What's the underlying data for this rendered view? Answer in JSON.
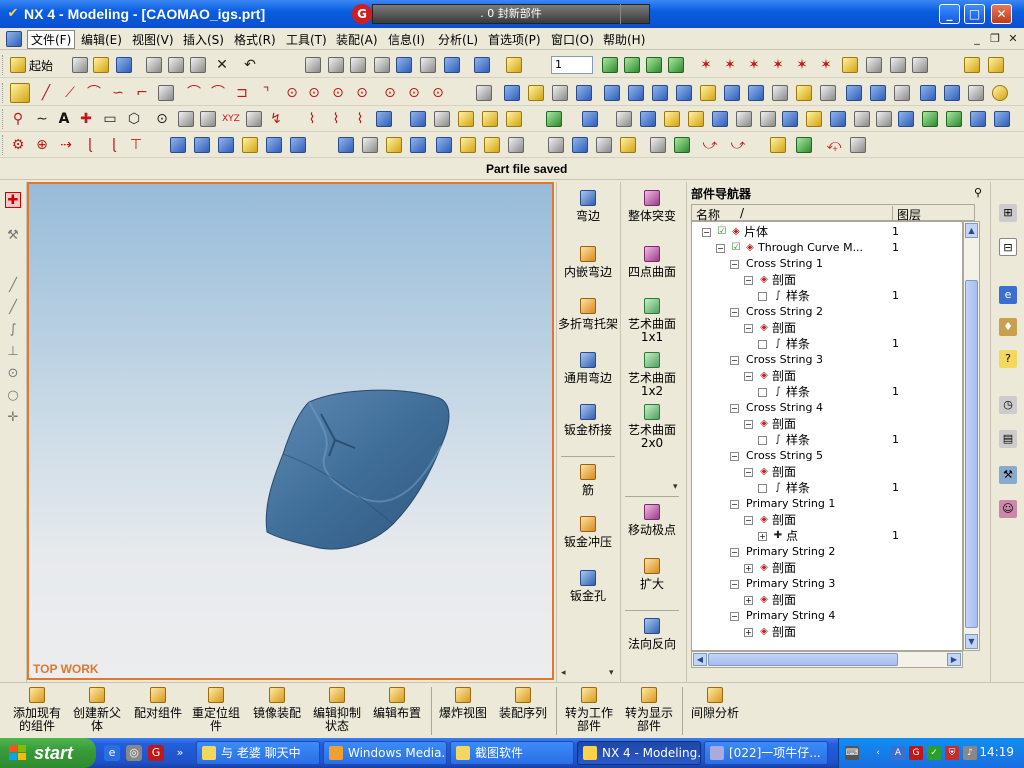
{
  "window": {
    "title": "NX 4 - Modeling - [CAOMAO_igs.prt]",
    "ext_bar_text": ". 0 封新部件",
    "controls": {
      "minimize": "_",
      "maximize": "□",
      "close": "✕"
    }
  },
  "menu": [
    {
      "label": "文件(F)"
    },
    {
      "label": "编辑(E)"
    },
    {
      "label": "视图(V)"
    },
    {
      "label": "插入(S)"
    },
    {
      "label": "格式(R)"
    },
    {
      "label": "工具(T)"
    },
    {
      "label": "装配(A)"
    },
    {
      "label": "信息(I)"
    },
    {
      "label": "分析(L)"
    },
    {
      "label": "首选项(P)"
    },
    {
      "label": "窗口(O)"
    },
    {
      "label": "帮助(H)"
    }
  ],
  "toolbar": {
    "start_label": "起始",
    "layer_value": "1"
  },
  "status_text": "Part file saved",
  "viewport": {
    "label": "TOP WORK",
    "model_color": "#3f6e98"
  },
  "palette_left": [
    {
      "label": "弯边"
    },
    {
      "label": "内嵌弯边"
    },
    {
      "label": "多折弯托架"
    },
    {
      "label": "通用弯边"
    },
    {
      "label": "钣金桥接"
    },
    {
      "label": "筋"
    },
    {
      "label": "钣金冲压"
    },
    {
      "label": "钣金孔"
    }
  ],
  "palette_right": [
    {
      "label": "整体突变",
      "sub": ""
    },
    {
      "label": "四点曲面",
      "sub": ""
    },
    {
      "label": "艺术曲面",
      "sub": "1x1"
    },
    {
      "label": "艺术曲面",
      "sub": "1x2"
    },
    {
      "label": "艺术曲面",
      "sub": "2x0"
    },
    {
      "label": "移动极点",
      "sub": ""
    },
    {
      "label": "扩大",
      "sub": ""
    },
    {
      "label": "法向反向",
      "sub": ""
    }
  ],
  "navigator": {
    "title": "部件导航器",
    "col_name": "名称",
    "col_sort": "/",
    "col_layer": "图层",
    "rows": [
      {
        "label": "片体",
        "layer": "1",
        "indent": 0,
        "exp": "−",
        "check": true
      },
      {
        "label": "Through Curve M...",
        "layer": "1",
        "indent": 1,
        "exp": "−",
        "check": true
      },
      {
        "label": "Cross String 1",
        "layer": "",
        "indent": 2,
        "exp": "−"
      },
      {
        "label": "剖面",
        "layer": "",
        "indent": 3,
        "exp": "−"
      },
      {
        "label": "样条",
        "layer": "1",
        "indent": 4,
        "exp": ""
      },
      {
        "label": "Cross String 2",
        "layer": "",
        "indent": 2,
        "exp": "−"
      },
      {
        "label": "剖面",
        "layer": "",
        "indent": 3,
        "exp": "−"
      },
      {
        "label": "样条",
        "layer": "1",
        "indent": 4,
        "exp": ""
      },
      {
        "label": "Cross String 3",
        "layer": "",
        "indent": 2,
        "exp": "−"
      },
      {
        "label": "剖面",
        "layer": "",
        "indent": 3,
        "exp": "−"
      },
      {
        "label": "样条",
        "layer": "1",
        "indent": 4,
        "exp": ""
      },
      {
        "label": "Cross String 4",
        "layer": "",
        "indent": 2,
        "exp": "−"
      },
      {
        "label": "剖面",
        "layer": "",
        "indent": 3,
        "exp": "−"
      },
      {
        "label": "样条",
        "layer": "1",
        "indent": 4,
        "exp": ""
      },
      {
        "label": "Cross String 5",
        "layer": "",
        "indent": 2,
        "exp": "−"
      },
      {
        "label": "剖面",
        "layer": "",
        "indent": 3,
        "exp": "−"
      },
      {
        "label": "样条",
        "layer": "1",
        "indent": 4,
        "exp": ""
      },
      {
        "label": "Primary String 1",
        "layer": "",
        "indent": 2,
        "exp": "−"
      },
      {
        "label": "剖面",
        "layer": "",
        "indent": 3,
        "exp": "−"
      },
      {
        "label": "点",
        "layer": "1",
        "indent": 4,
        "exp": "+"
      },
      {
        "label": "Primary String 2",
        "layer": "",
        "indent": 2,
        "exp": "−"
      },
      {
        "label": "剖面",
        "layer": "",
        "indent": 3,
        "exp": "+"
      },
      {
        "label": "Primary String 3",
        "layer": "",
        "indent": 2,
        "exp": "−"
      },
      {
        "label": "剖面",
        "layer": "",
        "indent": 3,
        "exp": "+"
      },
      {
        "label": "Primary String 4",
        "layer": "",
        "indent": 2,
        "exp": "−"
      },
      {
        "label": "剖面",
        "layer": "",
        "indent": 3,
        "exp": "+"
      }
    ]
  },
  "bottom_toolbar": [
    {
      "label": "添加现有的组件"
    },
    {
      "label": "创建新父体"
    },
    {
      "label": "配对组件"
    },
    {
      "label": "重定位组件"
    },
    {
      "label": "镜像装配"
    },
    {
      "label": "编辑抑制状态"
    },
    {
      "label": "编辑布置"
    },
    {
      "label": "爆炸视图"
    },
    {
      "label": "装配序列"
    },
    {
      "label": "转为工作部件"
    },
    {
      "label": "转为显示部件"
    },
    {
      "label": "间隙分析"
    }
  ],
  "taskbar": {
    "start_label": "start",
    "tasks": [
      {
        "label": "与 老婆 聊天中",
        "active": false
      },
      {
        "label": "Windows Media...",
        "active": false
      },
      {
        "label": "截图软件",
        "active": false
      },
      {
        "label": "NX 4 - Modeling...",
        "active": true
      },
      {
        "label": "[022]一项牛仔...",
        "active": false
      }
    ],
    "clock": "14:19"
  }
}
